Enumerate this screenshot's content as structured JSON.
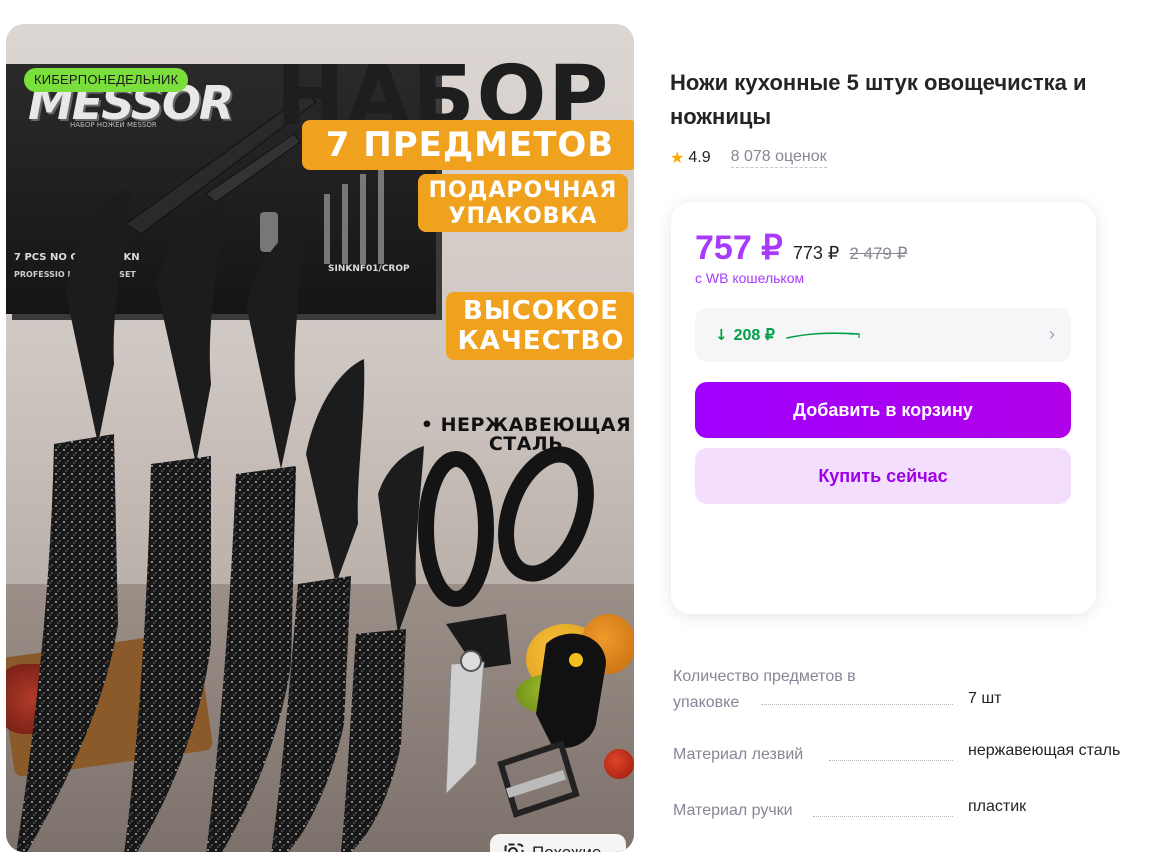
{
  "product_image": {
    "promo_badge": "КИБЕРПОНЕДЕЛЬНИК",
    "brand_logo": "MESSOR",
    "headline": "НАБОР",
    "tag_set": "7 ПРЕДМЕТОВ",
    "tag_gift_line1": "ПОДАРОЧНАЯ",
    "tag_gift_line2": "УПАКОВКА",
    "tag_quality_line1": "ВЫСОКОЕ",
    "tag_quality_line2": "КАЧЕСТВО",
    "steel_note_line1": "• НЕРЖАВЕЮЩАЯ",
    "steel_note_line2": "СТАЛЬ",
    "box_text_1": "7 PCS NO     COATING KN",
    "box_text_2": "PROFESSIO       LITY KNIFE SET",
    "box_text_3": "SINKNF01/CROP",
    "box_small": "НАБОР НОЖЕЙ MESSOR",
    "similar_button": "Похожие",
    "similar_icon": "image-search-icon"
  },
  "product": {
    "title": "Ножи кухонные 5 штук овощечистка и ножницы",
    "rating": "4.9",
    "reviews": "8 078 оценок"
  },
  "price": {
    "main": "757 ₽",
    "mid": "773 ₽",
    "old": "2 479 ₽",
    "wallet_note": "с WB кошельком",
    "history_delta": "208 ₽",
    "add_to_cart": "Добавить в корзину",
    "buy_now": "Купить сейчас"
  },
  "specs": [
    {
      "name": "Количество предметов в упаковке",
      "value": "7 шт"
    },
    {
      "name": "Материал лезвий",
      "value": "нержавеющая сталь"
    },
    {
      "name": "Материал ручки",
      "value": "пластик"
    }
  ],
  "colors": {
    "accent": "#a73afd",
    "button": "#a000f0",
    "price_down": "#00a046",
    "star": "#ffa800",
    "promo_badge": "#7adf3a",
    "orange_tag": "#f0a21e"
  }
}
